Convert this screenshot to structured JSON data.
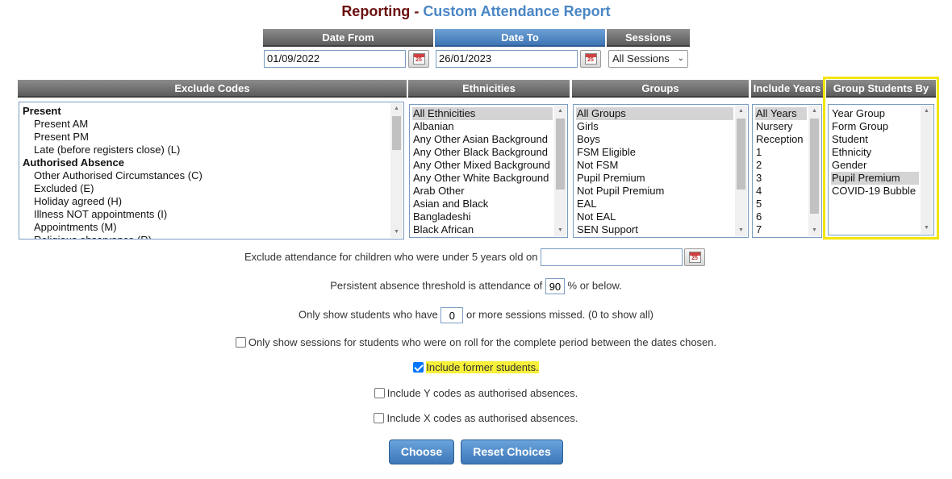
{
  "title": {
    "part1": "Reporting",
    "sep": " - ",
    "part2": "Custom Attendance Report"
  },
  "dates": {
    "from_label": "Date From",
    "from_value": "01/09/2022",
    "to_label": "Date To",
    "to_value": "26/01/2023",
    "sessions_label": "Sessions",
    "sessions_value": "All Sessions",
    "cal_day": "25"
  },
  "columns": {
    "exclude_codes": "Exclude Codes",
    "ethnicities": "Ethnicities",
    "groups": "Groups",
    "include_years": "Include Years",
    "group_by": "Group Students By"
  },
  "exclude_codes": [
    {
      "label": "Present",
      "type": "grp"
    },
    {
      "label": "Present AM",
      "type": "ind"
    },
    {
      "label": "Present PM",
      "type": "ind"
    },
    {
      "label": "Late (before registers close) (L)",
      "type": "ind"
    },
    {
      "label": "Authorised Absence",
      "type": "grp"
    },
    {
      "label": "Other Authorised Circumstances (C)",
      "type": "ind"
    },
    {
      "label": "Excluded (E)",
      "type": "ind"
    },
    {
      "label": "Holiday agreed (H)",
      "type": "ind"
    },
    {
      "label": "Illness NOT appointments (I)",
      "type": "ind"
    },
    {
      "label": "Appointments (M)",
      "type": "ind"
    },
    {
      "label": "Religious observance (R)",
      "type": "ind"
    }
  ],
  "ethnicities": [
    {
      "label": "All Ethnicities",
      "selected": true
    },
    {
      "label": "Albanian"
    },
    {
      "label": "Any Other Asian Background"
    },
    {
      "label": "Any Other Black Background"
    },
    {
      "label": "Any Other Mixed Background"
    },
    {
      "label": "Any Other White Background"
    },
    {
      "label": "Arab Other"
    },
    {
      "label": "Asian and Black"
    },
    {
      "label": "Bangladeshi"
    },
    {
      "label": "Black African"
    }
  ],
  "groups": [
    {
      "label": "All Groups",
      "selected": true
    },
    {
      "label": "Girls"
    },
    {
      "label": "Boys"
    },
    {
      "label": "FSM Eligible"
    },
    {
      "label": "Not FSM"
    },
    {
      "label": "Pupil Premium"
    },
    {
      "label": "Not Pupil Premium"
    },
    {
      "label": "EAL"
    },
    {
      "label": "Not EAL"
    },
    {
      "label": "SEN Support"
    }
  ],
  "years": [
    {
      "label": "All Years",
      "selected": true
    },
    {
      "label": "Nursery"
    },
    {
      "label": "Reception"
    },
    {
      "label": "1"
    },
    {
      "label": "2"
    },
    {
      "label": "3"
    },
    {
      "label": "4"
    },
    {
      "label": "5"
    },
    {
      "label": "6"
    },
    {
      "label": "7"
    }
  ],
  "group_by": [
    {
      "label": "Year Group"
    },
    {
      "label": "Form Group"
    },
    {
      "label": "Student"
    },
    {
      "label": "Ethnicity"
    },
    {
      "label": "Gender"
    },
    {
      "label": "Pupil Premium",
      "selected": true
    },
    {
      "label": "COVID-19 Bubble"
    }
  ],
  "options": {
    "under5_label": "Exclude attendance for children who were under 5 years old on",
    "under5_value": "",
    "pa_prefix": "Persistent absence threshold is attendance of",
    "pa_value": "90",
    "pa_suffix": "% or below.",
    "missed_prefix": "Only show students who have",
    "missed_value": "0",
    "missed_suffix": "or more sessions missed. (0 to show all)",
    "on_roll_label": "Only show sessions for students who were on roll for the complete period between the dates chosen.",
    "on_roll_checked": false,
    "former_label": "Include former students.",
    "former_checked": true,
    "ycodes_label": "Include Y codes as authorised absences.",
    "ycodes_checked": false,
    "xcodes_label": "Include X codes as authorised absences.",
    "xcodes_checked": false
  },
  "buttons": {
    "choose": "Choose",
    "reset": "Reset Choices"
  },
  "colors": {
    "title_dark": "#6b0f0f",
    "title_blue": "#4a86c5",
    "highlight_yellow": "#f2e500",
    "button_blue": "#3d77b8"
  }
}
